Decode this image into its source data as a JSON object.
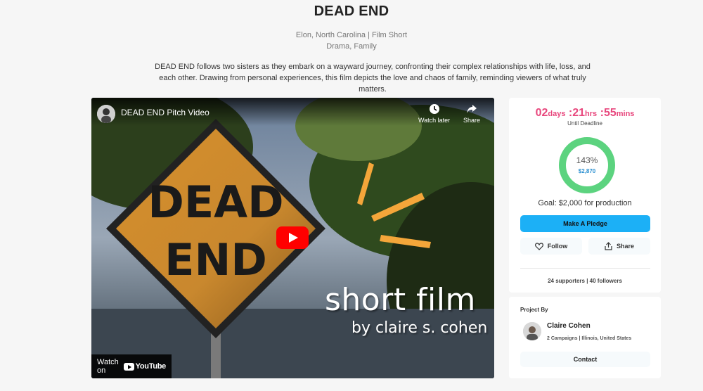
{
  "project": {
    "title": "DEAD END",
    "location_line": "Elon, North Carolina | Film Short",
    "genres": "Drama, Family",
    "description": "DEAD END follows two sisters as they embark on a wayward journey, confronting their complex relationships with life, loss, and each other. Drawing from personal experiences, this film depicts the love and chaos of family, reminding viewers of what truly matters."
  },
  "video": {
    "title": "DEAD END Pitch Video",
    "watch_later": "Watch later",
    "share": "Share",
    "watch_on": "Watch on",
    "youtube": "YouTube",
    "sign_word1": "DEAD",
    "sign_word2": "END",
    "overlay_line1": "short film",
    "overlay_line2": "by claire s. cohen"
  },
  "campaign": {
    "days": "02",
    "days_unit": "days",
    "hours": ":21",
    "hours_unit": "hrs",
    "mins": ":55",
    "mins_unit": "mins",
    "until": "Until Deadline",
    "percent": "143%",
    "raised": "$2,870",
    "goal": "Goal: $2,000 for production",
    "pledge_label": "Make A Pledge",
    "follow_label": "Follow",
    "share_label": "Share",
    "supporters": "24 supporters | 40 followers",
    "ring_color": "#5cd37f",
    "accent_pink": "#e8477d",
    "accent_blue": "#1cb0f6"
  },
  "creator": {
    "section_label": "Project By",
    "name": "Claire Cohen",
    "info": "2 Campaigns | Illinois, United States",
    "contact_label": "Contact"
  }
}
